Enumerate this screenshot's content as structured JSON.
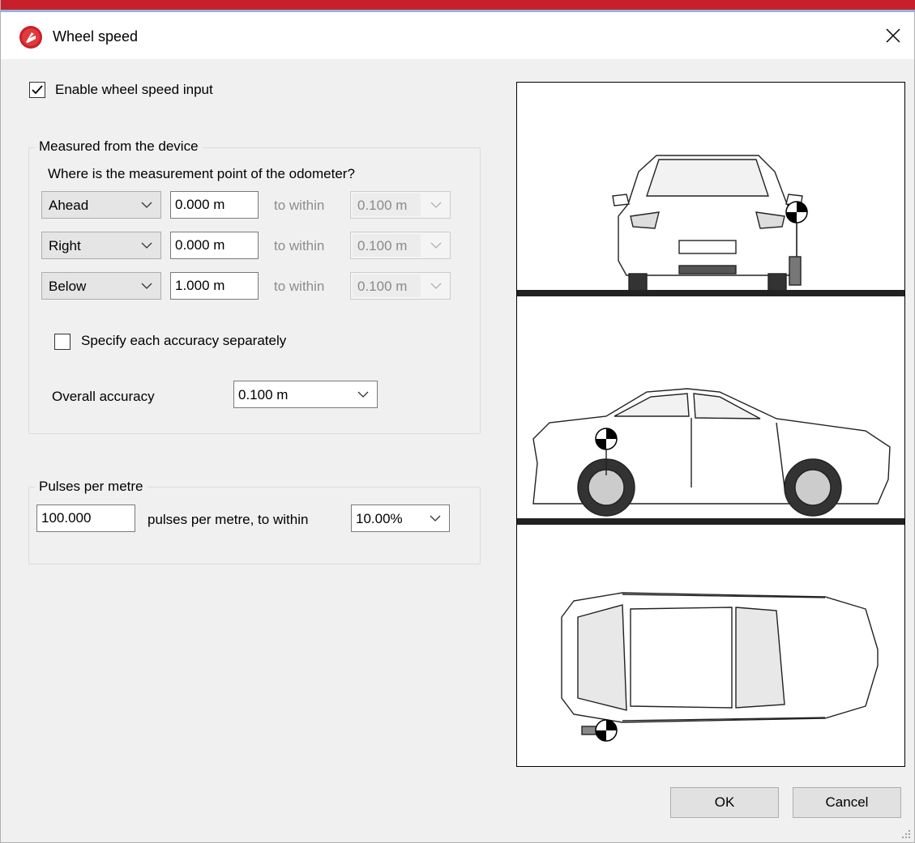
{
  "window": {
    "title": "Wheel speed"
  },
  "enable_checkbox": {
    "label": "Enable wheel speed input",
    "checked": true
  },
  "device_group": {
    "title": "Measured from the device",
    "question": "Where is the measurement point of the odometer?",
    "rows": [
      {
        "direction": "Ahead",
        "distance": "0.000 m",
        "within_label": "to within",
        "accuracy": "0.100 m"
      },
      {
        "direction": "Right",
        "distance": "0.000 m",
        "within_label": "to within",
        "accuracy": "0.100 m"
      },
      {
        "direction": "Below",
        "distance": "1.000 m",
        "within_label": "to within",
        "accuracy": "0.100 m"
      }
    ],
    "separate_accuracy": {
      "label": "Specify each accuracy separately",
      "checked": false
    },
    "overall_accuracy": {
      "label": "Overall accuracy",
      "value": "0.100 m"
    }
  },
  "pulses_group": {
    "title": "Pulses per metre",
    "value": "100.000",
    "label": "pulses per metre, to within",
    "tolerance": "10.00%"
  },
  "buttons": {
    "ok": "OK",
    "cancel": "Cancel"
  },
  "colors": {
    "accent": "#c8202a",
    "dialog_bg": "#f0f0f0"
  },
  "icons": [
    "app-logo-icon",
    "close-icon",
    "check-icon",
    "chevron-down-icon",
    "resize-grip-icon"
  ]
}
